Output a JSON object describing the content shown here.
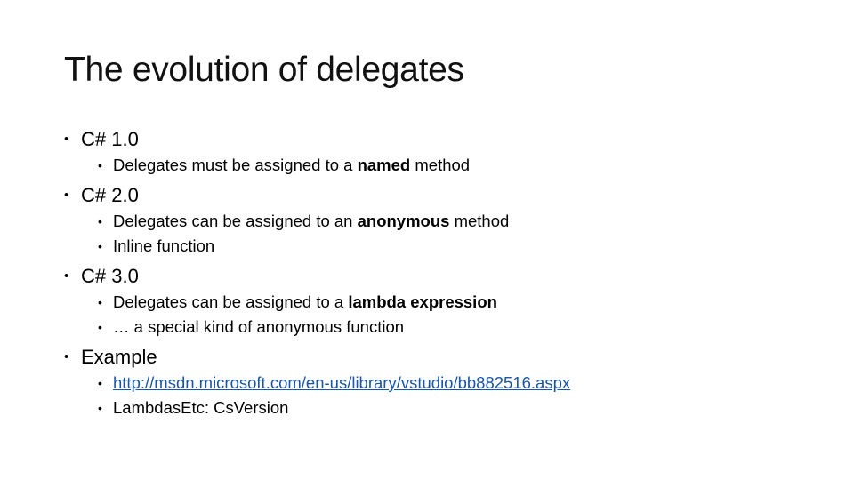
{
  "slide": {
    "title": "The evolution of delegates",
    "bullet_glyph": "•",
    "sections": [
      {
        "heading": "C# 1.0",
        "items": [
          {
            "pre": "Delegates must be assigned to a ",
            "bold": "named",
            "post": " method"
          }
        ]
      },
      {
        "heading": "C# 2.0",
        "items": [
          {
            "pre": "Delegates can be assigned to an ",
            "bold": "anonymous",
            "post": " method"
          },
          {
            "pre": "Inline function",
            "bold": "",
            "post": ""
          }
        ]
      },
      {
        "heading": "C# 3.0",
        "items": [
          {
            "pre": "Delegates can be assigned to a ",
            "bold": "lambda expression",
            "post": ""
          },
          {
            "pre": "… a special kind of anonymous function",
            "bold": "",
            "post": ""
          }
        ]
      },
      {
        "heading": "Example",
        "link": "http://msdn.microsoft.com/en-us/library/vstudio/bb882516.aspx",
        "items": [
          {
            "pre": "LambdasEtc: CsVersion",
            "bold": "",
            "post": ""
          }
        ]
      }
    ],
    "colors": {
      "link": "#1a56a8",
      "text": "#000000",
      "background": "#ffffff"
    }
  }
}
